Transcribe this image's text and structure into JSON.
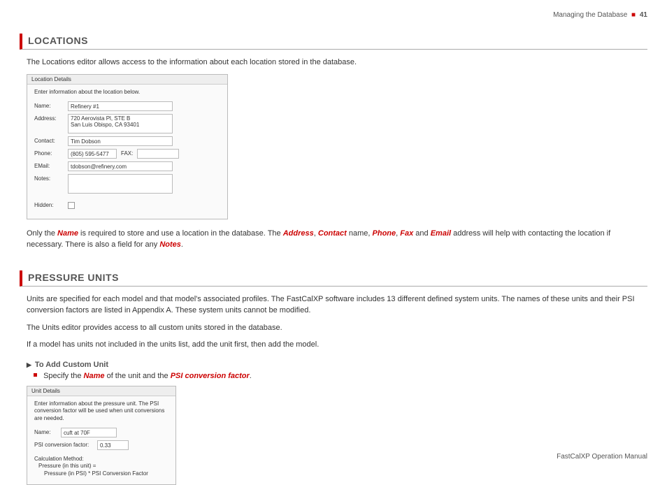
{
  "header": {
    "section": "Managing the Database",
    "page": "41"
  },
  "footer": {
    "text": "FastCalXP Operation Manual"
  },
  "locations": {
    "heading": "LOCATIONS",
    "intro": "The Locations editor allows access to the information about each location stored in the database.",
    "dialog": {
      "title": "Location Details",
      "instr": "Enter information about the location below.",
      "labels": {
        "name": "Name:",
        "address": "Address:",
        "contact": "Contact:",
        "phone": "Phone:",
        "fax": "FAX:",
        "email": "EMail:",
        "notes": "Notes:",
        "hidden": "Hidden:"
      },
      "values": {
        "name": "Refinery #1",
        "address": "720 Aerovista Pl, STE B\nSan Luis Obispo, CA 93401",
        "contact": "Tim Dobson",
        "phone": "(805) 595-5477",
        "fax": "",
        "email": "tdobson@refinery.com"
      }
    },
    "note_pre": "Only the ",
    "note_name": "Name",
    "note_mid1": " is required to store and use a location in the database. The ",
    "note_address": "Address",
    "note_sep1": ", ",
    "note_contact": "Contact",
    "note_mid2": " name, ",
    "note_phone": "Phone",
    "note_sep2": ", ",
    "note_fax": "Fax",
    "note_mid3": " and ",
    "note_email": "Email",
    "note_mid4": " address will help with contacting the location if necessary. There is also a field for any ",
    "note_notes": "Notes",
    "note_end": "."
  },
  "pressure": {
    "heading": "PRESSURE UNITS",
    "p1": "Units are specified for each model and that model's associated profiles. The FastCalXP software includes 13 different defined system units. The names of these units and their PSI conversion factors are listed in Appendix A. These system units cannot be modified.",
    "p2": "The Units editor provides access to all custom units stored in the database.",
    "p3": "If a model has units not included in the units list, add the unit first, then add the model.",
    "sub": "To Add Custom Unit",
    "bullet_pre": "Specify the ",
    "bullet_name": "Name",
    "bullet_mid": " of the unit and the ",
    "bullet_psi": "PSI conversion factor",
    "bullet_end": ".",
    "dialog": {
      "title": "Unit Details",
      "instr": "Enter information about the pressure unit. The PSI conversion factor will be used when unit conversions are needed.",
      "labels": {
        "name": "Name:",
        "psi": "PSI conversion factor:"
      },
      "values": {
        "name": "cuft at 70F",
        "psi": "0.33"
      },
      "calc1": "Calculation Method:",
      "calc2": "Pressure (in this unit) =",
      "calc3": "Pressure (in PSI) * PSI Conversion Factor"
    }
  }
}
